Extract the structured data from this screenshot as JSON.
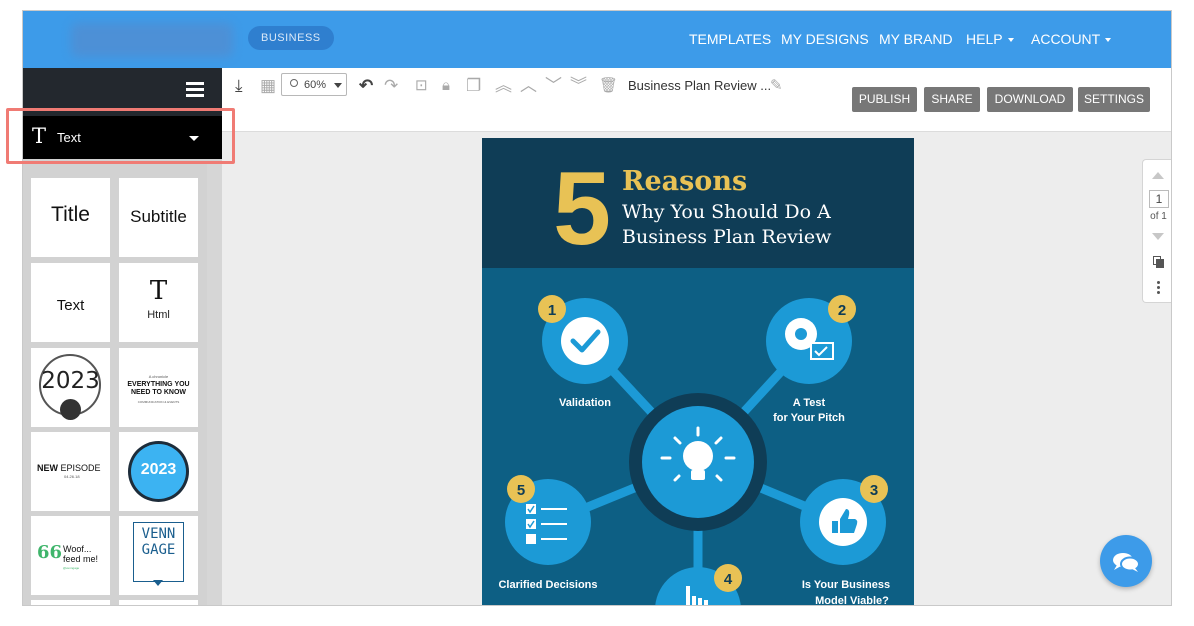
{
  "nav": {
    "badge": "BUSINESS",
    "items": [
      {
        "label": "TEMPLATES",
        "dropdown": false
      },
      {
        "label": "MY DESIGNS",
        "dropdown": false
      },
      {
        "label": "MY BRAND",
        "dropdown": false
      },
      {
        "label": "HELP",
        "dropdown": true
      },
      {
        "label": "ACCOUNT",
        "dropdown": true
      }
    ]
  },
  "sidebar": {
    "dropdown_label": "Text",
    "tiles": [
      {
        "label": "Title"
      },
      {
        "label": "Subtitle"
      },
      {
        "label": "Text"
      },
      {
        "glyph": "T",
        "sub": "Html"
      },
      {
        "text": "2023"
      },
      {
        "small": "A chronicle",
        "big": "EVERYTHING YOU NEED TO KNOW",
        "foot": "COMMUNICATION & EVENTS"
      },
      {
        "bold": "NEW",
        "rest": "EPISODE",
        "sub": "04.26.18"
      },
      {
        "text": "2023"
      },
      {
        "quote": "66",
        "line1": "Woof...",
        "line2": "feed me!",
        "foot": "@venngage"
      },
      {
        "line1": "VENN",
        "line2": "GAGE"
      }
    ]
  },
  "toolbar": {
    "zoom": "60%",
    "doc_title": "Business Plan Review ...",
    "buttons": [
      "PUBLISH",
      "SHARE",
      "DOWNLOAD",
      "SETTINGS"
    ]
  },
  "infographic": {
    "big_number": "5",
    "heading": "Reasons",
    "subheading_line1": "Why You Should Do A",
    "subheading_line2": "Business Plan Review",
    "items": [
      {
        "num": "1",
        "label_lines": [
          "Validation"
        ]
      },
      {
        "num": "2",
        "label_lines": [
          "A Test",
          "for Your Pitch"
        ]
      },
      {
        "num": "3",
        "label_lines": [
          "Is Your Business",
          "Model Viable?"
        ]
      },
      {
        "num": "4",
        "label_lines": []
      },
      {
        "num": "5",
        "label_lines": [
          "Clarified Decisions"
        ]
      }
    ],
    "colors": {
      "header_bg": "#0f3d56",
      "body_bg": "#0d5f84",
      "accent": "#e8c255",
      "circle": "#1c9ad6"
    }
  },
  "pager": {
    "page": "1",
    "of": "of 1"
  },
  "icons": [
    "hamburger-icon",
    "text-type-icon",
    "dropdown-caret-icon",
    "save-icon",
    "transparency-icon",
    "magnifier-icon",
    "undo-icon",
    "redo-icon",
    "crop-icon",
    "lock-icon",
    "duplicate-icon",
    "bring-front-icon",
    "bring-forward-icon",
    "send-backward-icon",
    "send-back-icon",
    "trash-icon",
    "edit-icon",
    "chat-icon"
  ]
}
